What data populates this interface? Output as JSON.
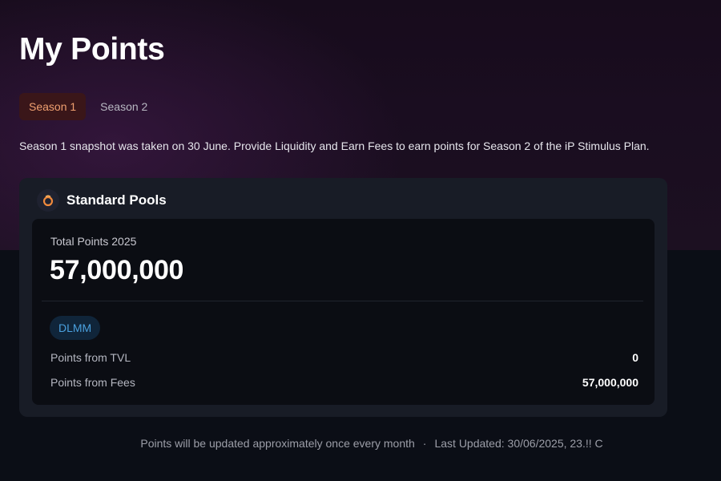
{
  "page": {
    "title": "My Points"
  },
  "tabs": [
    {
      "label": "Season 1",
      "active": true
    },
    {
      "label": "Season 2",
      "active": false
    }
  ],
  "description": "Season 1 snapshot was taken on 30 June. Provide Liquidity and Earn Fees to earn points for Season 2 of the iP Stimulus Plan.",
  "card": {
    "icon": "pool-ring-icon",
    "title": "Standard Pools",
    "total_label": "Total Points 2025",
    "total_value": "57,000,000",
    "badge": "DLMM",
    "rows": [
      {
        "label": "Points from TVL",
        "value": "0"
      },
      {
        "label": "Points from Fees",
        "value": "57,000,000"
      }
    ]
  },
  "footer": {
    "note": "Points will be updated approximately once every month",
    "separator": "·",
    "last_updated": "Last Updated: 30/06/2025, 23.!! C"
  },
  "colors": {
    "accent_tab_text": "#f0a070",
    "accent_tab_bg": "#3a1619",
    "badge_text": "#4aa0de",
    "badge_bg": "#10253a",
    "card_bg": "#181c26",
    "inner_bg": "#0b0d13"
  }
}
